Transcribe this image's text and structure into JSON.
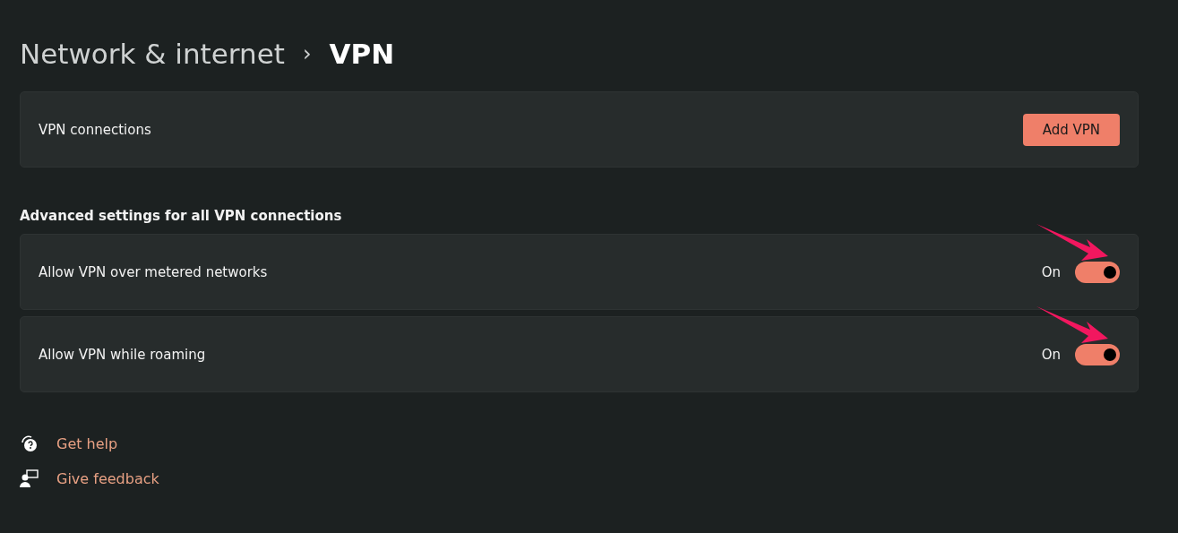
{
  "breadcrumb": {
    "parent": "Network & internet",
    "separator": "›",
    "current": "VPN"
  },
  "connections": {
    "label": "VPN connections",
    "button": "Add VPN"
  },
  "advanced": {
    "heading": "Advanced settings for all VPN connections",
    "settings": [
      {
        "label": "Allow VPN over metered networks",
        "state": "On",
        "on": true,
        "annotated": true
      },
      {
        "label": "Allow VPN while roaming",
        "state": "On",
        "on": true,
        "annotated": true
      }
    ]
  },
  "links": [
    {
      "kind": "help",
      "label": "Get help"
    },
    {
      "kind": "feedback",
      "label": "Give feedback"
    }
  ]
}
